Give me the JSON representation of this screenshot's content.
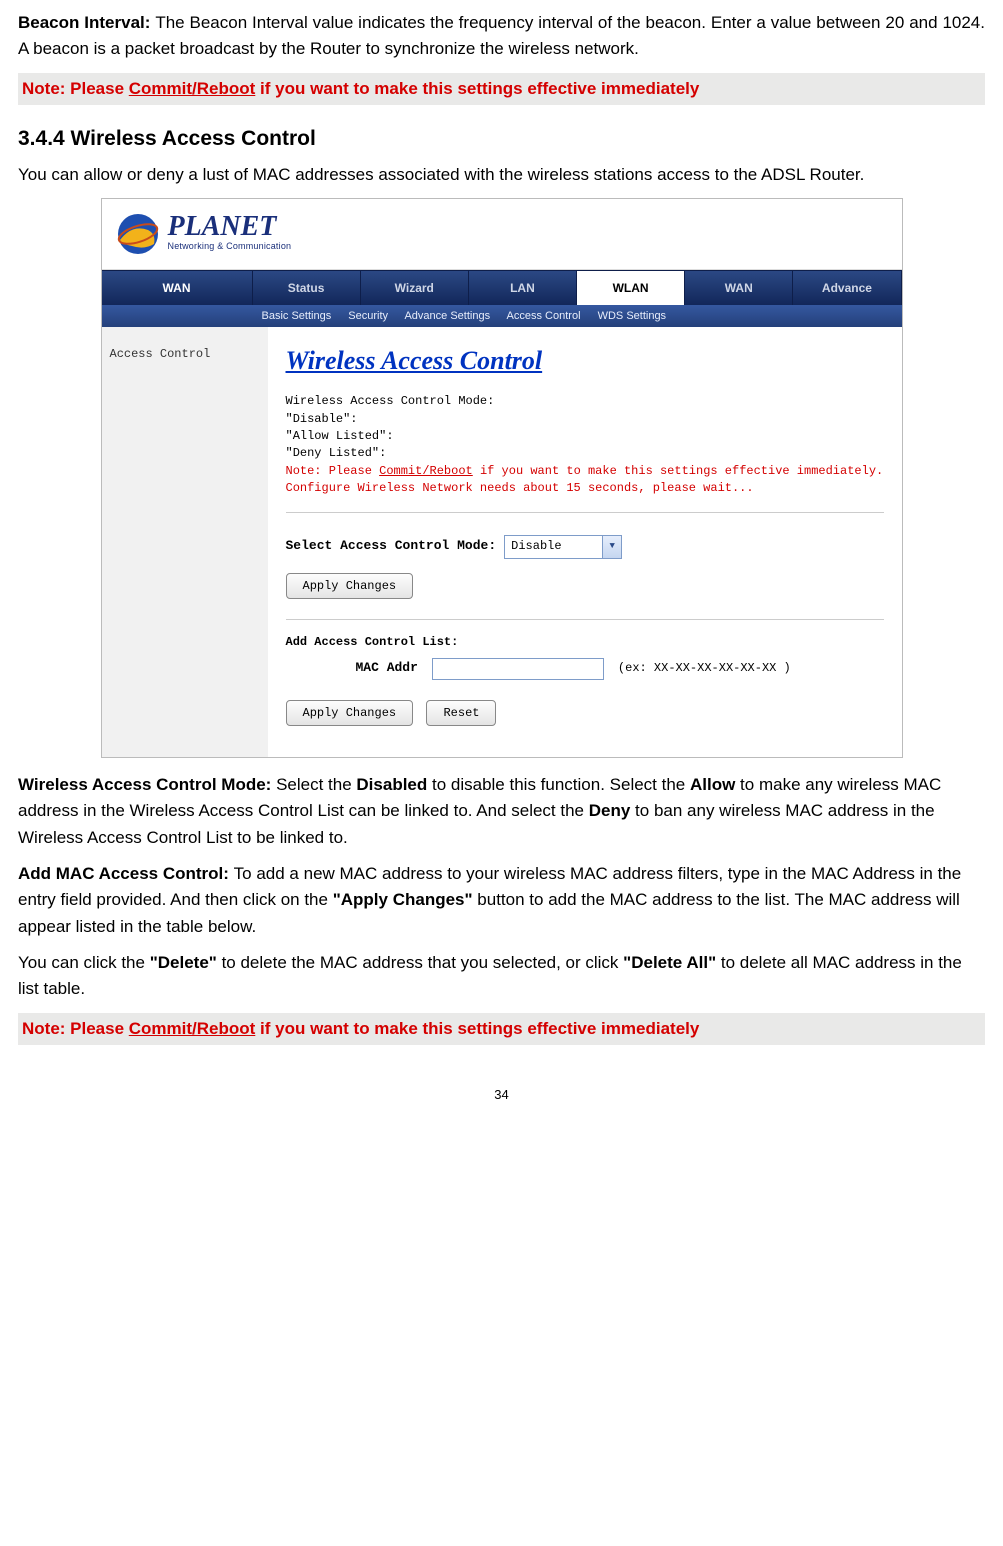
{
  "intro": {
    "beacon_label": "Beacon Interval: ",
    "beacon_text": "The Beacon Interval value indicates the frequency interval of the beacon. Enter a value between 20 and 1024. A beacon is a packet broadcast by the Router to synchronize the wireless network."
  },
  "note1": {
    "prefix": "Note: Please ",
    "link": "Commit/Reboot",
    "suffix": " if you want to make this settings effective immediately"
  },
  "section": {
    "heading": "3.4.4 Wireless Access Control",
    "intro": "You can allow or deny a lust of MAC addresses associated with the wireless stations access to the ADSL Router."
  },
  "screenshot": {
    "logo": {
      "name": "PLANET",
      "tag": "Networking & Communication"
    },
    "nav": {
      "col0": "WAN",
      "col1": "Status",
      "col2": "Wizard",
      "col3": "LAN",
      "col4": "WLAN",
      "col5": "WAN",
      "col6": "Advance"
    },
    "subnav": {
      "s0": "Basic Settings",
      "s1": "Security",
      "s2": "Advance Settings",
      "s3": "Access Control",
      "s4": "WDS Settings"
    },
    "side": "Access Control",
    "title": "Wireless Access Control",
    "mode_head": "Wireless Access Control Mode:",
    "mode_1": "\"Disable\":",
    "mode_2": "\"Allow Listed\":",
    "mode_3": "\"Deny Listed\":",
    "note_pre": "Note: Please ",
    "note_link": "Commit/Reboot",
    "note_post": " if you want to make this settings effective immediately.",
    "wait": "Configure Wireless Network needs about 15 seconds, please wait...",
    "select_label": "Select Access Control Mode:",
    "select_value": "Disable",
    "btn_apply": "Apply Changes",
    "add_head": "Add Access Control List:",
    "mac_label": "MAC Addr",
    "mac_example": "(ex: XX-XX-XX-XX-XX-XX )",
    "btn_reset": "Reset"
  },
  "p_mode": {
    "t1": "Wireless Access Control Mode: ",
    "t2": "Select the ",
    "t3": "Disabled",
    "t4": " to disable this function. Select the ",
    "t5": "Allow",
    "t6": " to make any wireless MAC address in the Wireless Access Control List can be linked to. And select the ",
    "t7": "Deny",
    "t8": " to ban any wireless MAC address in the Wireless Access Control List to be linked to."
  },
  "p_add": {
    "t1": "Add MAC Access Control: ",
    "t2": "To add a new MAC address to your wireless MAC address filters, type in the MAC Address in the entry field provided. And then click on the ",
    "t3": "\"Apply Changes\"",
    "t4": " button to add the MAC address to the list. The MAC address will appear listed in the table below."
  },
  "p_del": {
    "t1": "You can click the ",
    "t2": "\"Delete\"",
    "t3": " to delete the MAC address that you selected, or click ",
    "t4": "\"Delete All\"",
    "t5": " to delete all MAC address in the list table."
  },
  "note2": {
    "prefix": "Note: Please ",
    "link": "Commit/Reboot",
    "suffix": " if you want to make this settings effective immediately"
  },
  "page_number": "34"
}
